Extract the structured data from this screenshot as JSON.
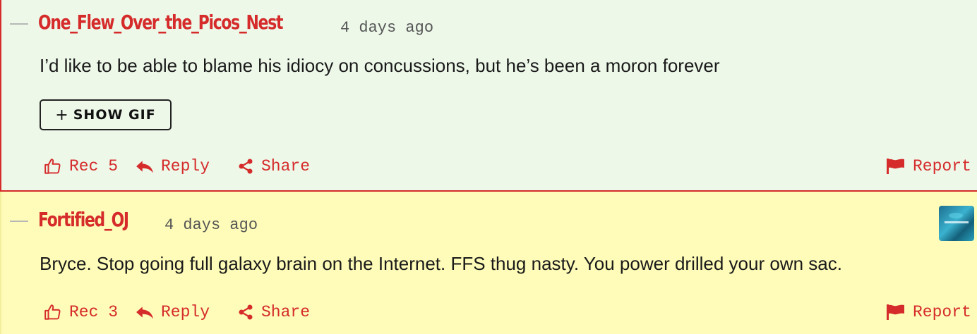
{
  "comments": [
    {
      "author": "One_Flew_Over_the_Picos_Nest",
      "time": "4 days ago",
      "body": "I’d like to be able to blame his idiocy on concussions, but he’s been a moron forever",
      "gif_button": "SHOW GIF",
      "gif_plus": "+",
      "rec_label": "Rec 5",
      "reply_label": "Reply",
      "share_label": "Share",
      "report_label": "Report",
      "background": "#edf8e9"
    },
    {
      "author": "Fortified_OJ",
      "time": "4 days ago",
      "body": "Bryce. Stop going full galaxy brain on the Internet. FFS thug nasty. You power drilled your own sac.",
      "rec_label": "Rec 3",
      "reply_label": "Reply",
      "share_label": "Share",
      "report_label": "Report",
      "background": "#fefcb8",
      "avatar_icon": "user-avatar-image"
    }
  ],
  "colors": {
    "accent": "#d52b2b",
    "text": "#1a1a1a",
    "meta": "#555555"
  },
  "icons": {
    "rec": "thumbs-up-icon",
    "reply": "reply-arrow-icon",
    "share": "share-icon",
    "report": "flag-icon",
    "collapse": "collapse-dash-icon"
  }
}
